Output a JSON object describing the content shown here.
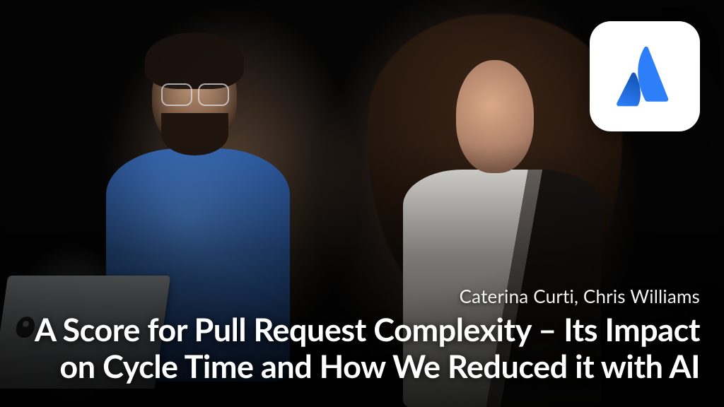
{
  "thumbnail": {
    "speakers_line": "Caterina Curti, Chris Williams",
    "title": "A Score for Pull Request Complexity – Its Impact on Cycle Time and How We Reduced it with AI",
    "logo": {
      "name": "atlassian",
      "colors": {
        "dark": "#1558BC",
        "light": "#2D7FF9"
      }
    }
  }
}
